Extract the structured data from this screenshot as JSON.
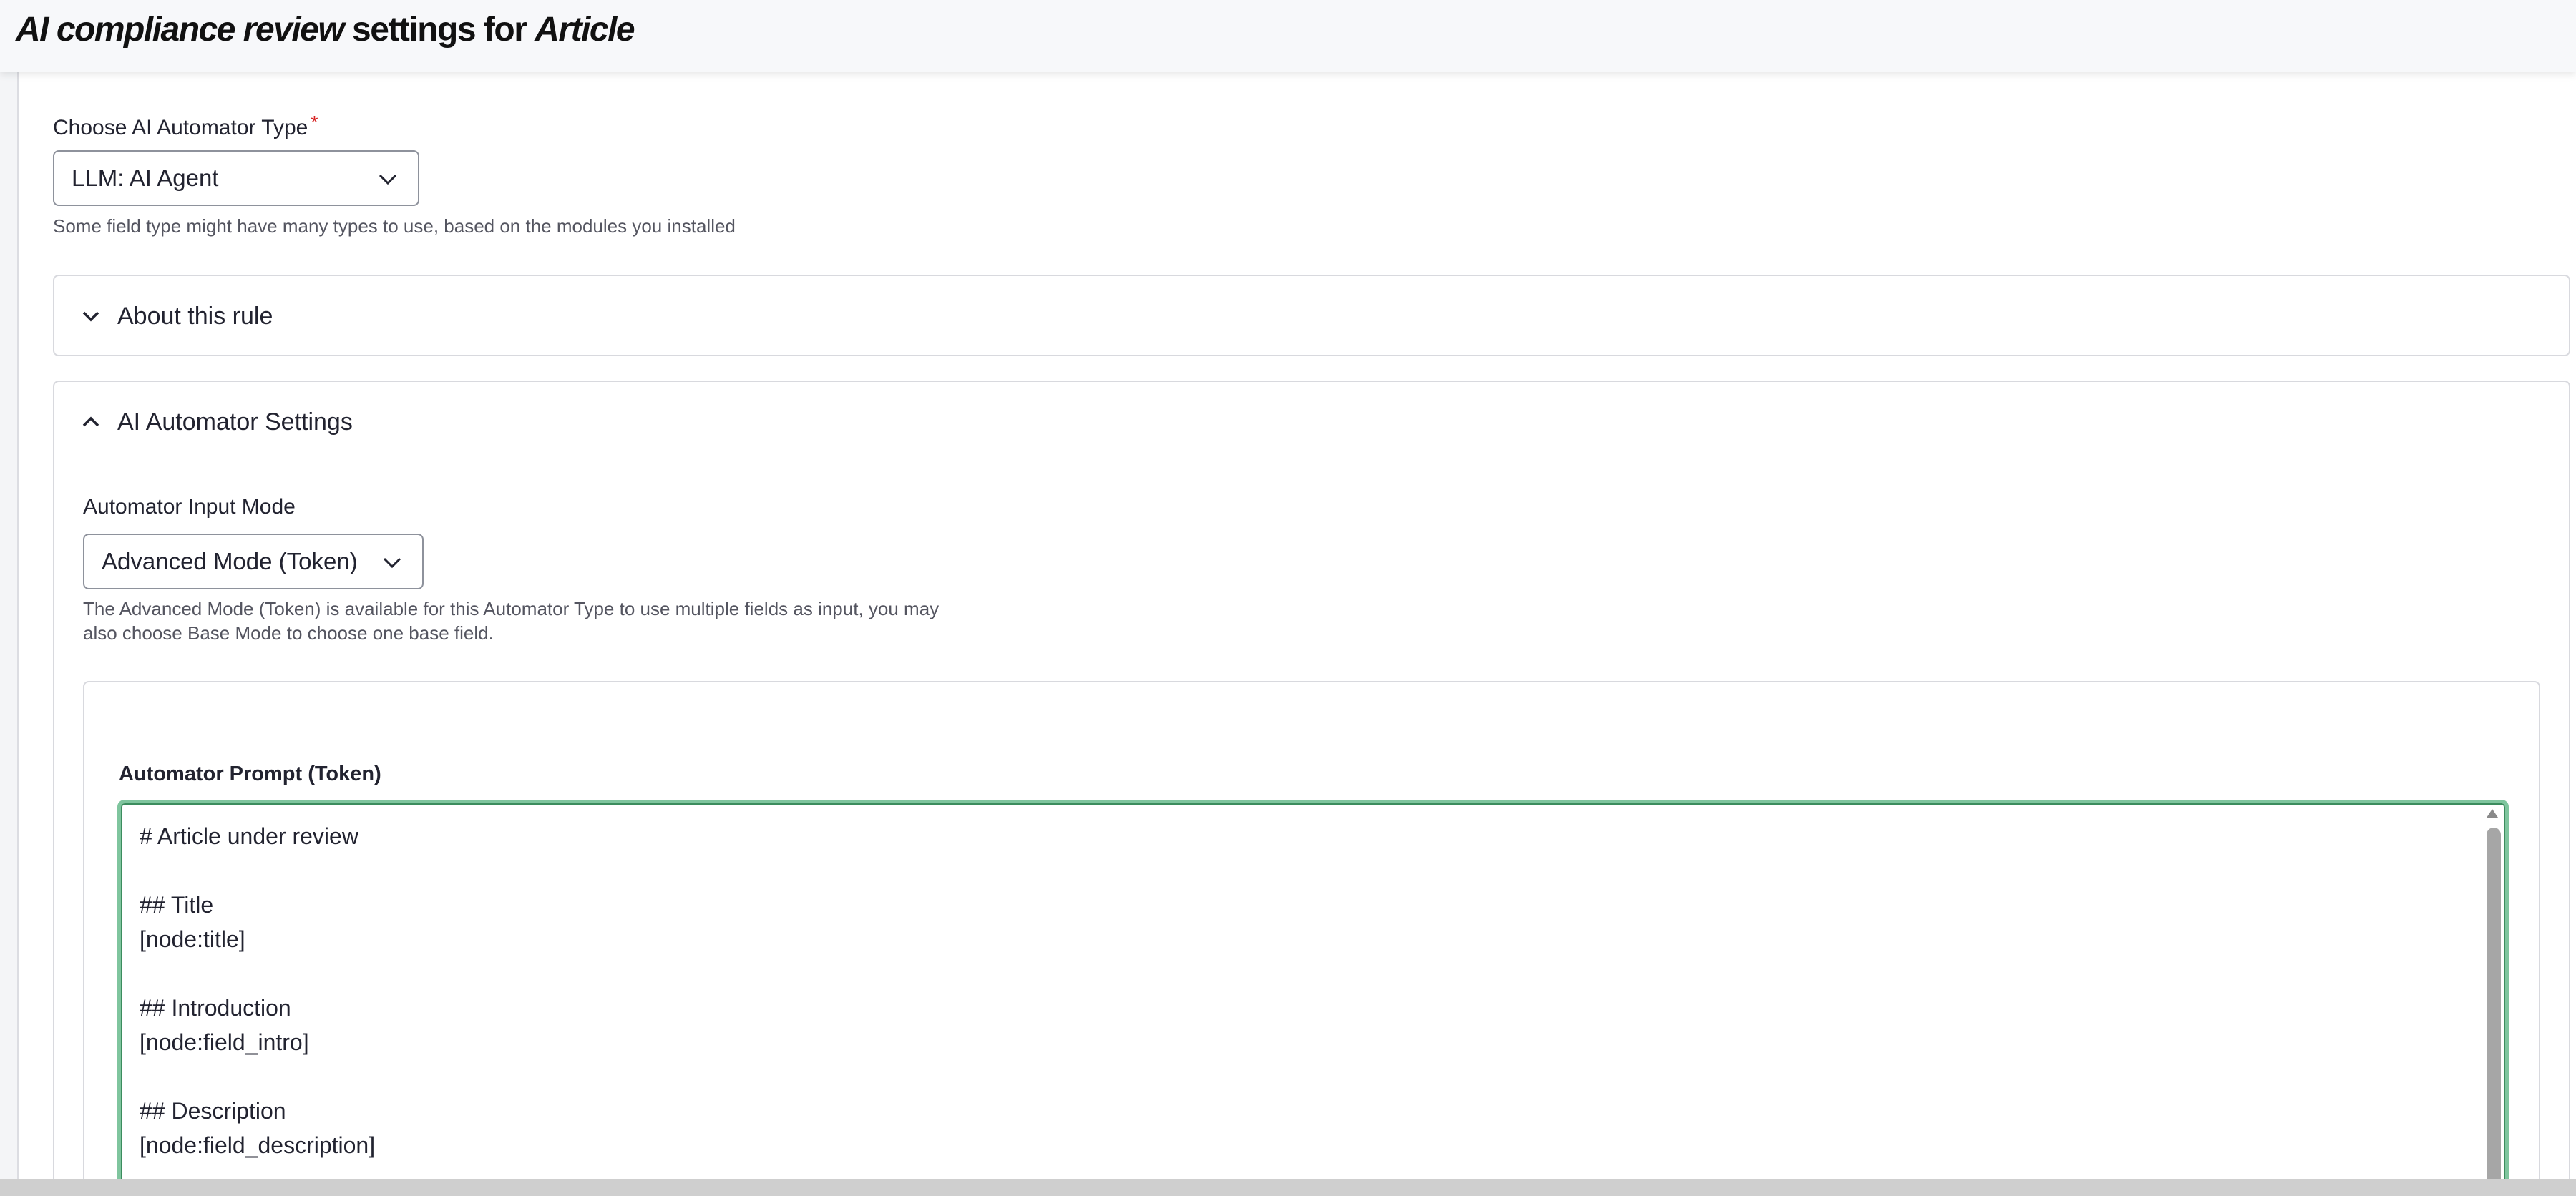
{
  "header": {
    "title_part1": "AI compliance review",
    "title_part2": " settings for ",
    "title_part3": "Article"
  },
  "automator_type": {
    "label": "Choose AI Automator Type",
    "required_marker": "*",
    "selected": "LLM: AI Agent",
    "description": "Some field type might have many types to use, based on the modules you installed"
  },
  "about_rule": {
    "summary": "About this rule",
    "expanded": false
  },
  "automator_settings": {
    "summary": "AI Automator Settings",
    "expanded": true,
    "input_mode": {
      "label": "Automator Input Mode",
      "selected": "Advanced Mode (Token)",
      "description_line1": "The Advanced Mode (Token) is available for this Automator Type to use multiple fields as input, you may",
      "description_line2": "also choose Base Mode to choose one base field."
    },
    "prompt": {
      "label": "Automator Prompt (Token)",
      "value": "# Article under review\n\n## Title\n[node:title]\n\n## Introduction\n[node:field_intro]\n\n## Description\n[node:field_description]"
    }
  },
  "icons": {
    "select_arrow": "chevron-down-icon",
    "collapsed": "chevron-down-icon",
    "expanded": "chevron-up-icon"
  },
  "colors": {
    "focus_border": "#7fc59e",
    "required": "#d72222"
  }
}
